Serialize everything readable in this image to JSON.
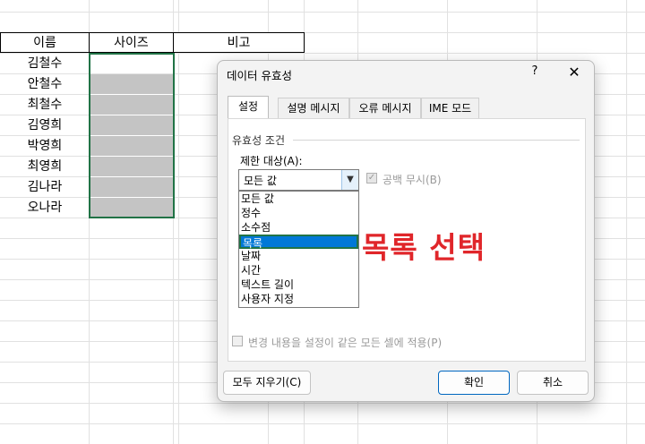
{
  "sheet": {
    "headers": [
      "이름",
      "사이즈",
      "비고"
    ],
    "names": [
      "김철수",
      "안철수",
      "최철수",
      "김영희",
      "박영희",
      "최영희",
      "김나라",
      "오나라"
    ]
  },
  "dialog": {
    "title": "데이터 유효성",
    "help": "?",
    "close": "✕",
    "tabs": [
      "설정",
      "설명 메시지",
      "오류 메시지",
      "IME 모드"
    ],
    "group_label": "유효성 조건",
    "allow_label": "제한 대상(A):",
    "allow_value": "모든 값",
    "ignore_blank": "공백 무시(B)",
    "options": [
      "모든 값",
      "정수",
      "소수점",
      "목록",
      "날짜",
      "시간",
      "텍스트 길이",
      "사용자 지정"
    ],
    "selected_index": 3,
    "apply_all": "변경 내용을 설정이 같은 모든 셀에 적용(P)",
    "clear_all": "모두 지우기(C)",
    "ok": "확인",
    "cancel": "취소"
  },
  "annotation": "목록 선택",
  "colors": {
    "selection_border": "#217346",
    "highlight": "#0078d7",
    "annotation": "#e0262a"
  }
}
